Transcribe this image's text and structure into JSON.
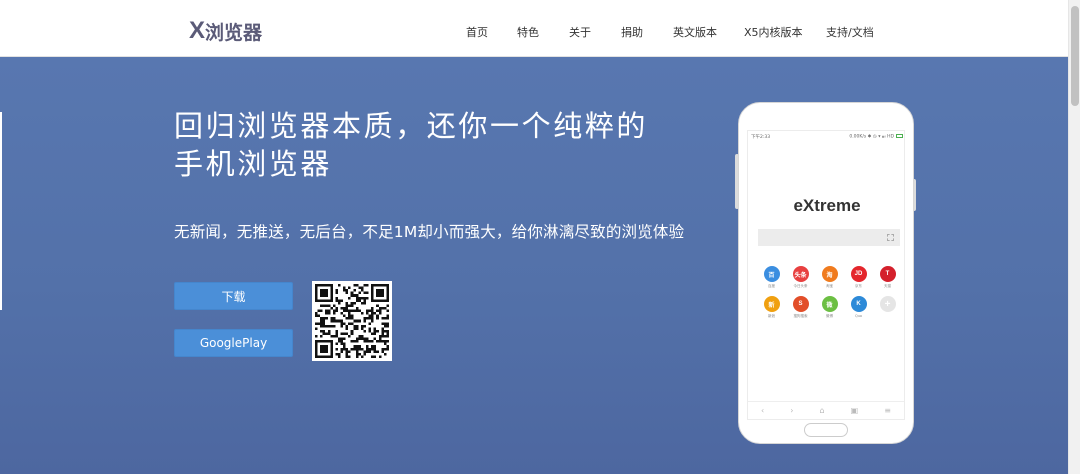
{
  "header": {
    "logo_x": "X",
    "logo_text": "浏览器",
    "nav": [
      "首页",
      "特色",
      "关于",
      "捐助",
      "英文版本",
      "X5内核版本",
      "支持/文档"
    ]
  },
  "hero": {
    "headline_line1": "回归浏览器本质，还你一个纯粹的",
    "headline_line2": "手机浏览器",
    "subtitle": "无新闻，无推送，无后台，不足1M却小而强大，给你淋漓尽致的浏览体验",
    "download_label": "下载",
    "googleplay_label": "GooglePlay"
  },
  "phone": {
    "status_left": "下午2:33",
    "status_right": "0.00K/s ✱ ◷ ▾ ▴ᵢₗ HD",
    "brand": "eXtreme",
    "apps": [
      {
        "glyph": "百",
        "label": "百度",
        "color": "#3b8ee0",
        "icon": "baidu-icon"
      },
      {
        "glyph": "头条",
        "label": "今日头条",
        "color": "#e84040",
        "icon": "toutiao-icon"
      },
      {
        "glyph": "淘",
        "label": "淘宝",
        "color": "#f07b1e",
        "icon": "taobao-icon"
      },
      {
        "glyph": "JD",
        "label": "京东",
        "color": "#e4262c",
        "icon": "jd-icon"
      },
      {
        "glyph": "T",
        "label": "天猫",
        "color": "#d4202c",
        "icon": "tmall-icon"
      },
      {
        "glyph": "新",
        "label": "新浪",
        "color": "#f0a010",
        "icon": "sina-icon"
      },
      {
        "glyph": "S",
        "label": "搜狗搜索",
        "color": "#e24e29",
        "icon": "sogou-icon"
      },
      {
        "glyph": "微",
        "label": "微博",
        "color": "#6cbf43",
        "icon": "weibo-icon"
      },
      {
        "glyph": "K",
        "label": "Quo",
        "color": "#2d8ad8",
        "icon": "quo-icon"
      },
      {
        "glyph": "+",
        "label": "",
        "color": "#e5e5e5",
        "icon": "add-icon"
      }
    ],
    "toolbar": [
      "‹",
      "›",
      "⌂",
      "▣",
      "≡"
    ]
  },
  "colors": {
    "hero_bg": "#5371a9",
    "button_bg": "#4b8fd8",
    "logo": "#5b5b78"
  }
}
